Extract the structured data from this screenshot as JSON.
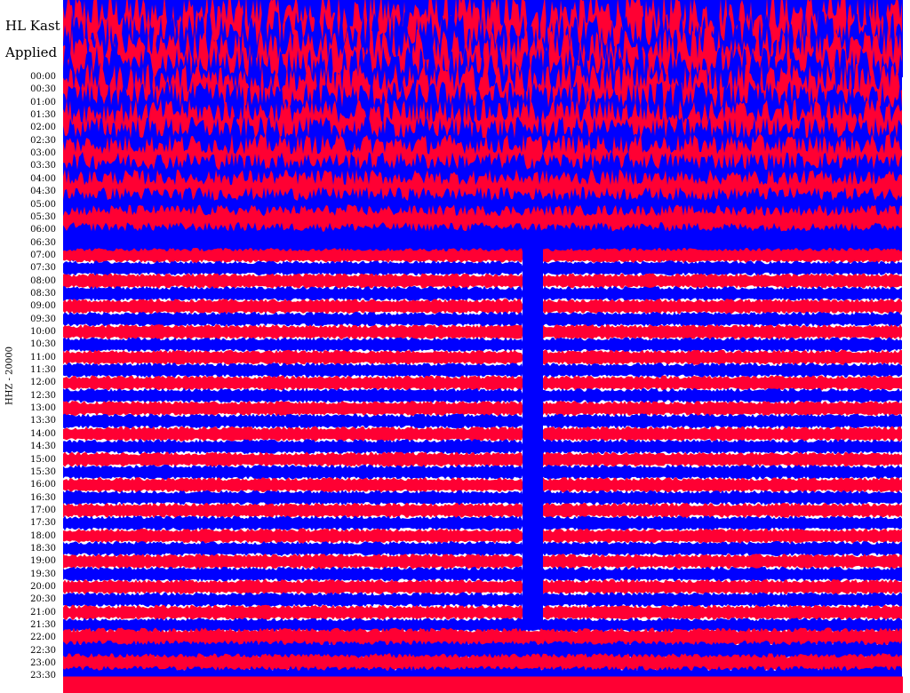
{
  "chart_data": {
    "type": "line",
    "title_lines": [
      "HL Kast",
      "Applied"
    ],
    "ylabel": "HHZ - 20000",
    "xlabel": "",
    "y_ticks": [
      "00:00",
      "00:30",
      "01:00",
      "01:30",
      "02:00",
      "02:30",
      "03:00",
      "03:30",
      "04:00",
      "04:30",
      "05:00",
      "05:30",
      "06:00",
      "06:30",
      "07:00",
      "07:30",
      "08:00",
      "08:30",
      "09:00",
      "09:30",
      "10:00",
      "10:30",
      "11:00",
      "11:30",
      "12:00",
      "12:30",
      "13:00",
      "13:30",
      "14:00",
      "14:30",
      "15:00",
      "15:30",
      "16:00",
      "16:30",
      "17:00",
      "17:30",
      "18:00",
      "18:30",
      "19:00",
      "19:30",
      "20:00",
      "20:30",
      "21:00",
      "21:30",
      "22:00",
      "22:30",
      "23:00",
      "23:30"
    ],
    "trace_colors": [
      "#ff0033",
      "#0000ff"
    ],
    "background": "#ffffff",
    "grid": false,
    "description": "Seismic helicorder: one trace per 30-minute row, alternating red and blue; large amplitude overnight, smaller during the day, with a gap between roughly 08:00 and 21:00 in each row."
  }
}
